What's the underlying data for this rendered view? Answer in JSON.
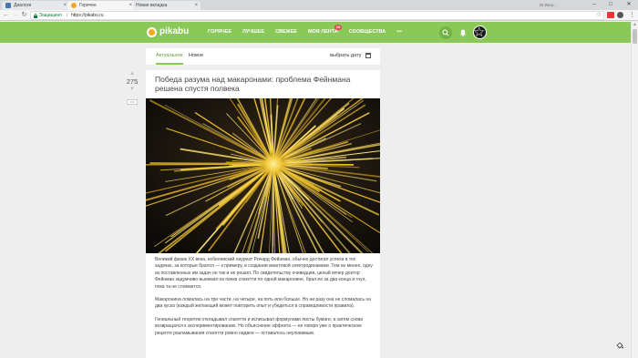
{
  "browser": {
    "tabs": [
      {
        "label": "Диалоги",
        "favicon_color": "#4a76a8",
        "active": false
      },
      {
        "label": "Горячее",
        "favicon_color": "#f5a623",
        "active": true
      },
      {
        "label": "Новая вкладка",
        "favicon_color": "",
        "active": false
      }
    ],
    "user_label": "Dr.Reui...",
    "address": {
      "secure_label": "Защищено",
      "separator": "|",
      "url": "https://pikabu.ru"
    },
    "window_controls": {
      "minimize": "–",
      "maximize": "□",
      "close": "✕"
    },
    "nav": {
      "back": "←",
      "forward": "→",
      "reload": "↻"
    },
    "tab_close": "×",
    "star": "☆",
    "menu": "⋮"
  },
  "site": {
    "logo": "pikabu",
    "accent": "#8ac858",
    "nav": [
      {
        "label": "ГОРЯЧЕЕ",
        "active": true
      },
      {
        "label": "ЛУЧШЕЕ"
      },
      {
        "label": "СВЕЖЕЕ"
      },
      {
        "label": "МОЯ ЛЕНТА",
        "badge": "15"
      },
      {
        "label": "СООБЩЕСТВА"
      },
      {
        "label": "•••"
      }
    ]
  },
  "filters": {
    "tab_actual": "Актуальное",
    "tab_new": "Новое",
    "date_label": "выбрать дату"
  },
  "story": {
    "rating": "275",
    "vote_up": "▲",
    "vote_down": "▼",
    "save_label": "•••",
    "title": "Победа разума над макаронами: проблема Фейнмана решена спустя полвека",
    "paragraphs": [
      "Великий физик XX века, нобелевский лауреат Ричард Фейнман, обычно достигал успеха в тех задачах, за которые брался — к примеру, в создании квантовой электродинамики. Тем не менее, одну из поставленных им задач он так и не решил. По свидетельству очевидцев, целый вечер доктор Фейнман задумчиво вынимал из пачки спагетти по одной макаронине, брал ее за два конца и гнул, пока та не сломается.",
      "Макаронина ломалась на три части, на четыре, на пять или больше. Но ни разу она не сломалась на два куска (каждый желающий может повторить опыт и убедиться в справедливости правила).",
      "Гениальный теоретик откладывал спагетти и исписывал формулами листы бумаги, а затем снова возвращался к экспериментированию. Но объяснение эффекта — не говоря уже о практическом рецепте разламывания спагетти ровно надвое — оставалось неуловимым."
    ]
  }
}
